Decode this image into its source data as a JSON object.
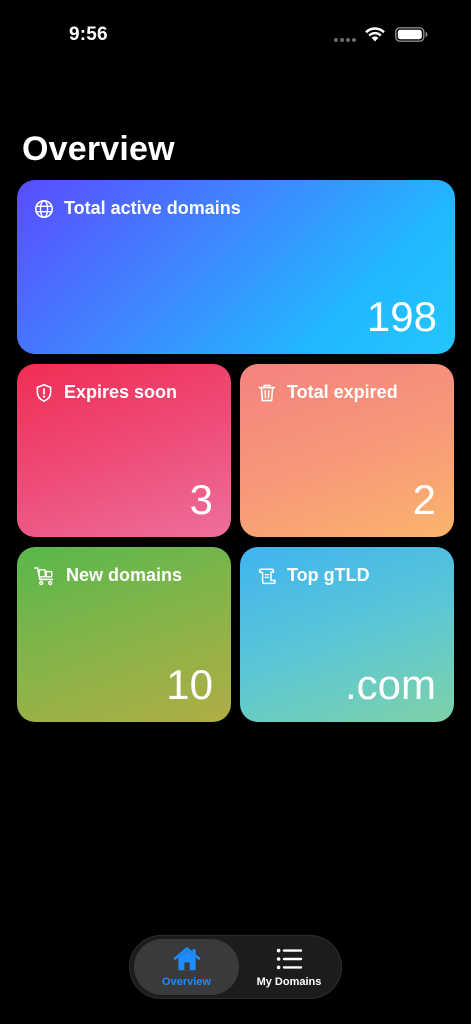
{
  "status_bar": {
    "time": "9:56",
    "icons": [
      "signal-dots-icon",
      "wifi-icon",
      "battery-icon"
    ]
  },
  "page": {
    "title": "Overview"
  },
  "cards": {
    "total_active": {
      "label": "Total active domains",
      "value": "198",
      "icon": "globe-icon"
    },
    "expires_soon": {
      "label": "Expires soon",
      "value": "3",
      "icon": "shield-alert-icon"
    },
    "total_expired": {
      "label": "Total expired",
      "value": "2",
      "icon": "trash-icon"
    },
    "new_domains": {
      "label": "New domains",
      "value": "10",
      "icon": "cart-icon"
    },
    "top_gtld": {
      "label": "Top gTLD",
      "value": ".com",
      "icon": "scroll-icon"
    }
  },
  "tab_bar": {
    "overview": {
      "label": "Overview",
      "icon": "house-icon",
      "selected": true
    },
    "my_domains": {
      "label": "My Domains",
      "icon": "list-icon",
      "selected": false
    }
  },
  "colors": {
    "accent": "#1e8bff",
    "background": "#000000"
  }
}
